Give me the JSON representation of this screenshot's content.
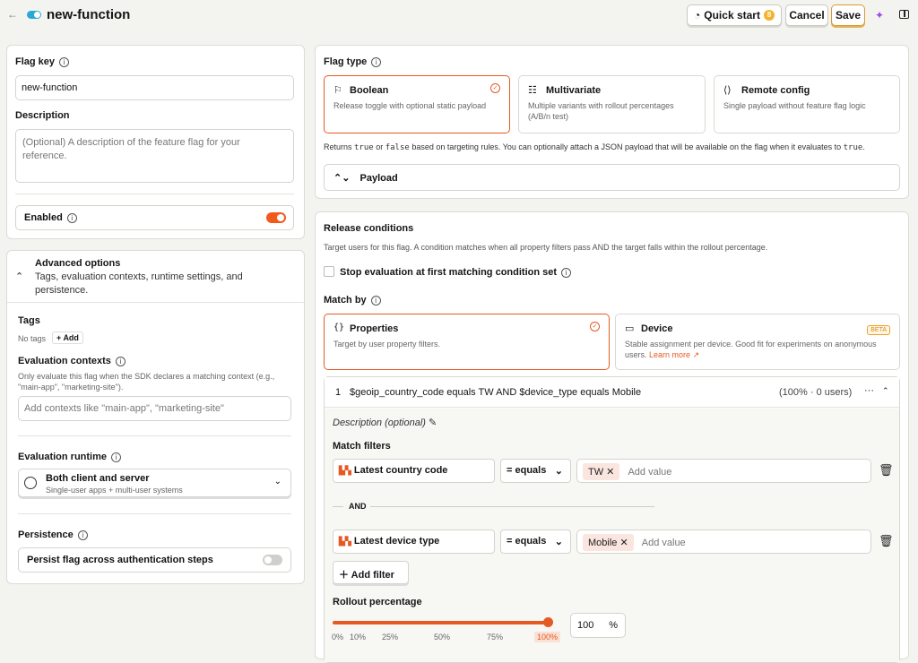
{
  "header": {
    "back_icon": "arrow-left-icon",
    "title": "new-function",
    "quick_start": "Quick start",
    "quick_start_badge": "8",
    "cancel": "Cancel",
    "save": "Save"
  },
  "left": {
    "flag_key_label": "Flag key",
    "flag_key_value": "new-function",
    "description_label": "Description",
    "description_placeholder": "(Optional) A description of the feature flag for your reference.",
    "enabled_label": "Enabled",
    "advanced_title": "Advanced options",
    "advanced_desc": "Tags, evaluation contexts, runtime settings, and persistence.",
    "tags_label": "Tags",
    "no_tags": "No tags",
    "add": "Add",
    "eval_ctx_label": "Evaluation contexts",
    "eval_ctx_help": "Only evaluate this flag when the SDK declares a matching context (e.g., \"main-app\", \"marketing-site\").",
    "eval_ctx_placeholder": "Add contexts like \"main-app\", \"marketing-site\"",
    "runtime_label": "Evaluation runtime",
    "runtime_value": "Both client and server",
    "runtime_sub": "Single-user apps + multi-user systems",
    "persistence_label": "Persistence",
    "persist_toggle_label": "Persist flag across authentication steps"
  },
  "flag_type": {
    "label": "Flag type",
    "options": [
      {
        "title": "Boolean",
        "desc": "Release toggle with optional static payload",
        "icon": "flag-icon"
      },
      {
        "title": "Multivariate",
        "desc": "Multiple variants with rollout percentages (A/B/n test)",
        "icon": "list-icon"
      },
      {
        "title": "Remote config",
        "desc": "Single payload without feature flag logic",
        "icon": "code-icon"
      }
    ],
    "returns_1": "Returns ",
    "true": "true",
    "or": " or ",
    "false": "false",
    "returns_2": " based on targeting rules. You can optionally attach a JSON payload that will be available on the flag when it evaluates to ",
    "true2": "true",
    "period": ".",
    "payload": "Payload"
  },
  "release": {
    "title": "Release conditions",
    "desc": "Target users for this flag. A condition matches when all property filters pass AND the target falls within the rollout percentage.",
    "stop_eval": "Stop evaluation at first matching condition set",
    "match_by": "Match by",
    "properties_title": "Properties",
    "properties_desc": "Target by user property filters.",
    "device_title": "Device",
    "device_beta": "BETA",
    "device_desc": "Stable assignment per device. Good fit for experiments on anonymous users.",
    "learn_more": "Learn more",
    "condition_index": "1",
    "condition_text": "$geoip_country_code equals TW AND $device_type equals Mobile",
    "condition_stats": "(100% · 0 users)",
    "more": "···",
    "desc_optional": "Description (optional)",
    "match_filters": "Match filters",
    "filter1_prop": "Latest country code",
    "filter1_op": "= equals",
    "filter1_tag": "TW",
    "filter1_add": "Add value",
    "and": "AND",
    "filter2_prop": "Latest device type",
    "filter2_op": "= equals",
    "filter2_tag": "Mobile",
    "filter2_add": "Add value",
    "add_filter": "Add filter",
    "rollout_label": "Rollout percentage",
    "rollout_value": "100",
    "rollout_unit": "%",
    "rollout_fraction": 1.0,
    "ticks": [
      "0%",
      "10%",
      "25%",
      "50%",
      "75%",
      "100%"
    ]
  },
  "colors": {
    "accent": "#e55a23",
    "beta": "#f0a020"
  }
}
